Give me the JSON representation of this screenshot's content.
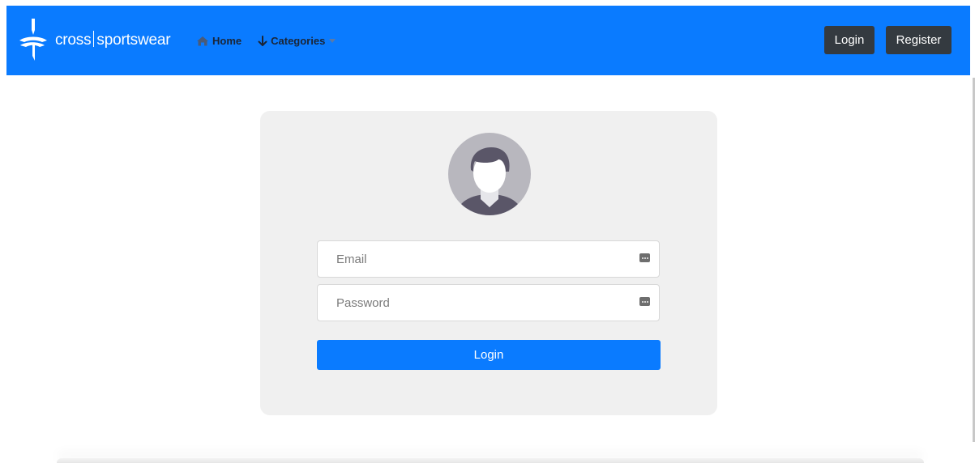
{
  "navbar": {
    "brand": {
      "name_left": "cross",
      "name_right": "sportswear",
      "logo": "cross-sportswear-logo"
    },
    "links": [
      {
        "label": "Home",
        "icon": "home-icon"
      },
      {
        "label": "Categories",
        "icon": "arrow-down-icon",
        "has_dropdown": true
      }
    ],
    "login_label": "Login",
    "register_label": "Register",
    "bg_color": "#0a7bff"
  },
  "login_form": {
    "avatar_icon": "user-avatar-icon",
    "email": {
      "placeholder": "Email",
      "value": "",
      "icon": "password-manager-icon"
    },
    "password": {
      "placeholder": "Password",
      "value": "",
      "icon": "password-manager-icon"
    },
    "submit_label": "Login",
    "accent_color": "#0a7bff",
    "card_color": "#f0f0f0"
  }
}
